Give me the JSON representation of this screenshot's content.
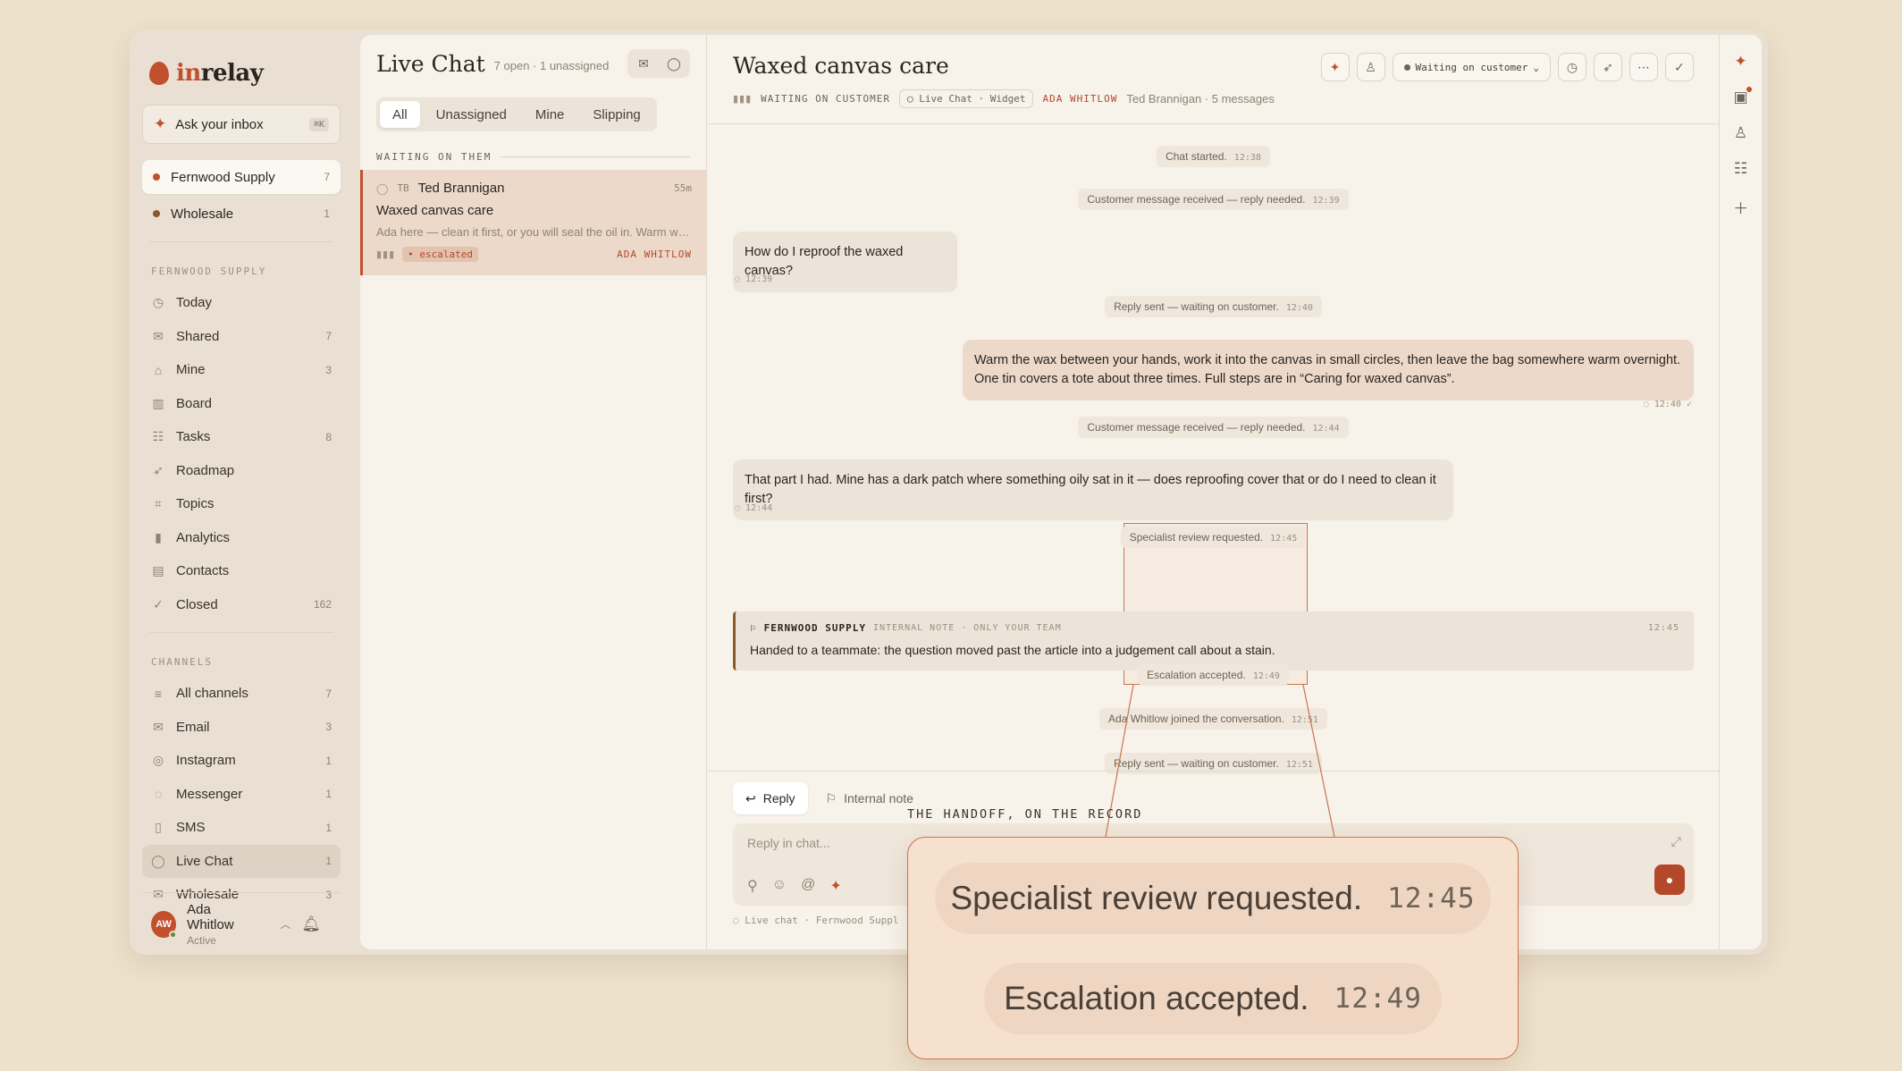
{
  "brand": {
    "name_prefix": "in",
    "name_suffix": "relay"
  },
  "ask": {
    "label": "Ask your inbox",
    "shortcut": "⌘K"
  },
  "workspaces": [
    {
      "name": "Fernwood Supply",
      "count": "7"
    },
    {
      "name": "Wholesale",
      "count": "1"
    }
  ],
  "nav_section_title": "FERNWOOD SUPPLY",
  "nav": [
    {
      "label": "Today",
      "icon": "clock-icon",
      "count": ""
    },
    {
      "label": "Shared",
      "icon": "inbox-icon",
      "count": "7"
    },
    {
      "label": "Mine",
      "icon": "user-inbox-icon",
      "count": "3"
    },
    {
      "label": "Board",
      "icon": "board-icon",
      "count": ""
    },
    {
      "label": "Tasks",
      "icon": "tasks-icon",
      "count": "8"
    },
    {
      "label": "Roadmap",
      "icon": "rocket-icon",
      "count": ""
    },
    {
      "label": "Topics",
      "icon": "tag-icon",
      "count": ""
    },
    {
      "label": "Analytics",
      "icon": "chart-icon",
      "count": ""
    },
    {
      "label": "Contacts",
      "icon": "contacts-icon",
      "count": ""
    },
    {
      "label": "Closed",
      "icon": "check-icon",
      "count": "162"
    }
  ],
  "channels_title": "CHANNELS",
  "channels": [
    {
      "label": "All channels",
      "count": "7"
    },
    {
      "label": "Email",
      "count": "3"
    },
    {
      "label": "Instagram",
      "count": "1"
    },
    {
      "label": "Messenger",
      "count": "1"
    },
    {
      "label": "SMS",
      "count": "1"
    },
    {
      "label": "Live Chat",
      "count": "1"
    },
    {
      "label": "Wholesale",
      "count": "3"
    }
  ],
  "user": {
    "initials": "AW",
    "name": "Ada Whitlow",
    "status": "Active"
  },
  "list": {
    "title": "Live Chat",
    "subtitle": "7 open · 1 unassigned",
    "tabs": [
      "All",
      "Unassigned",
      "Mine",
      "Slipping"
    ],
    "group": "WAITING ON THEM",
    "item": {
      "initials": "TB",
      "name": "Ted Brannigan",
      "time": "55m",
      "subject": "Waxed canvas care",
      "preview": "Ada here — clean it first, or you will seal the oil in. Warm wat...",
      "badge": "• escalated",
      "assignee": "ADA WHITLOW"
    }
  },
  "conversation": {
    "title": "Waxed canvas care",
    "status_tag": "WAITING ON CUSTOMER",
    "channel_pill": "Live Chat · Widget",
    "assignee": "ADA WHITLOW",
    "meta": "Ted Brannigan · 5 messages",
    "status_select": "Waiting on customer",
    "events": {
      "started": {
        "text": "Chat started.",
        "time": "12:38"
      },
      "received1": {
        "text": "Customer message received — reply needed.",
        "time": "12:39"
      },
      "sent1": {
        "text": "Reply sent — waiting on customer.",
        "time": "12:40"
      },
      "received2": {
        "text": "Customer message received — reply needed.",
        "time": "12:44"
      },
      "review": {
        "text": "Specialist review requested.",
        "time": "12:45"
      },
      "accepted": {
        "text": "Escalation accepted.",
        "time": "12:49"
      },
      "joined": {
        "text": "Ada Whitlow joined the conversation.",
        "time": "12:51"
      },
      "sent2": {
        "text": "Reply sent — waiting on customer.",
        "time": "12:51"
      }
    },
    "messages": {
      "m1": {
        "text": "How do I reproof the waxed canvas?",
        "time": "12:39"
      },
      "m2": {
        "text": "Warm the wax between your hands, work it into the canvas in small circles, then leave the bag somewhere warm overnight. One tin covers a tote about three times. Full steps are in “Caring for waxed canvas”.",
        "time": "12:40"
      },
      "m3": {
        "text": "That part I had. Mine has a dark patch where something oily sat in it — does reproofing cover that or do I need to clean it first?",
        "time": "12:44"
      }
    },
    "note": {
      "team": "FERNWOOD SUPPLY",
      "tag": "INTERNAL NOTE · ONLY YOUR TEAM",
      "time": "12:45",
      "body": "Handed to a teammate: the question moved past the article into a judgement call about a stain."
    }
  },
  "composer": {
    "reply_tab": "Reply",
    "note_tab": "Internal note",
    "placeholder": "Reply in chat...",
    "footer": "Live chat · Fernwood Suppl"
  },
  "callout": {
    "label": "THE HANDOFF, ON THE RECORD",
    "line1": "Specialist review requested.",
    "time1": "12:45",
    "line2": "Escalation accepted.",
    "time2": "12:49"
  },
  "colors": {
    "accent": "#c2502c",
    "background": "#ede1cc",
    "panel": "#f7f2ea"
  }
}
